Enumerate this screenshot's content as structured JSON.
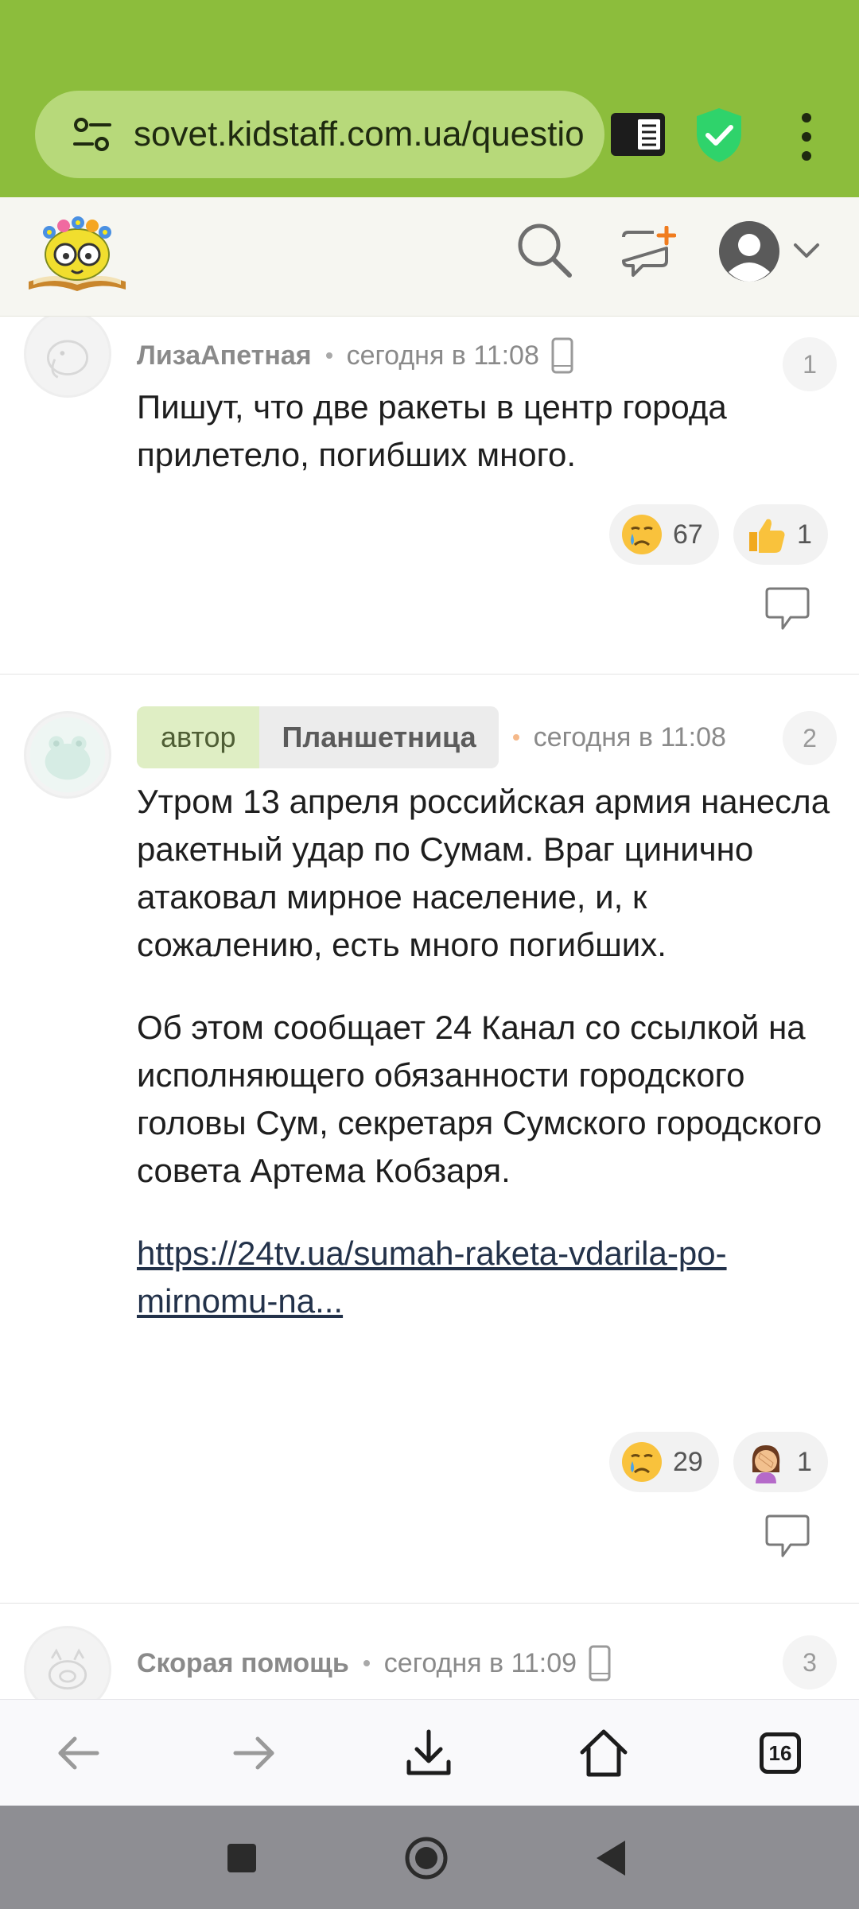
{
  "browser": {
    "url": "sovet.kidstaff.com.ua/questio",
    "tabs_count": "16"
  },
  "comments": [
    {
      "author": "ЛизаАпетная",
      "time": "сегодня в 11:08",
      "number": "1",
      "text": "Пишут, что две ракеты в центр города прилетело, погибших много.",
      "reactions": [
        {
          "emoji": "crying-face",
          "count": "67"
        },
        {
          "emoji": "thumbs-up",
          "count": "1"
        }
      ]
    },
    {
      "author_tag": "автор",
      "author": "Планшетница",
      "time": "сегодня в 11:08",
      "number": "2",
      "paragraph1": "Утром 13 апреля российская армия нанесла ракетный удар по Сумам. Враг цинично атаковал мирное население, и, к сожалению, есть много погибших.",
      "paragraph2": "Об этом сообщает 24 Канал со ссылкой на исполняющего обязанности городского головы Сум, секретаря Сумского городского совета Артема Кобзаря.",
      "link_line1": "https://24tv.ua/sumah-raketa-vdarila-po-",
      "link_line2": "mirnomu-na...",
      "reactions": [
        {
          "emoji": "crying-face",
          "count": "29"
        },
        {
          "emoji": "woman-facepalming",
          "count": "1"
        }
      ]
    },
    {
      "author": "Скорая помощь",
      "time": "сегодня в 11:09",
      "number": "3"
    }
  ],
  "colors": {
    "browser_green": "#8cbd3c",
    "url_pill": "#b7d97a",
    "shield_green": "#2fd36b",
    "author_tag_bg": "#dfeec4"
  }
}
